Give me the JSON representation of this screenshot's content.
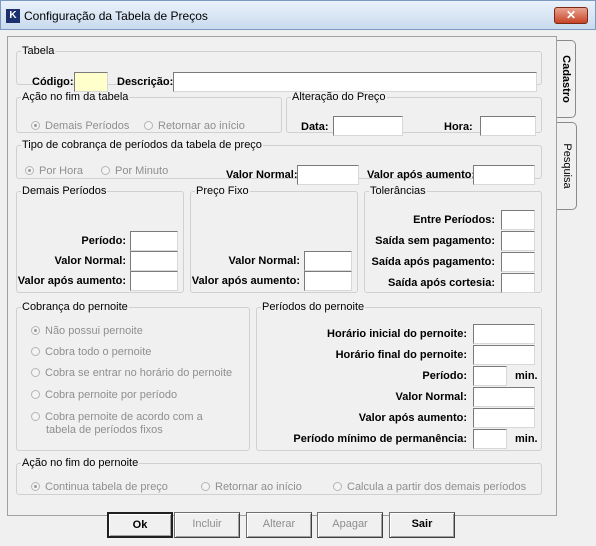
{
  "window": {
    "title": "Configuração da Tabela de Preços",
    "close_label": "✕",
    "icon_text": "K"
  },
  "tabs": [
    {
      "label": "Cadastro"
    },
    {
      "label": "Pesquisa"
    }
  ],
  "tabela": {
    "legend": "Tabela",
    "codigo_label": "Código:",
    "codigo_value": "",
    "descricao_label": "Descrição:",
    "descricao_value": ""
  },
  "acao_fim_tabela": {
    "legend": "Ação no fim da tabela",
    "options": [
      {
        "label": "Demais Períodos",
        "selected": true
      },
      {
        "label": "Retornar ao início",
        "selected": false
      }
    ]
  },
  "alteracao_preco": {
    "legend": "Alteração do Preço",
    "data_label": "Data:",
    "data_value": "",
    "hora_label": "Hora:",
    "hora_value": ""
  },
  "tipo_cobranca": {
    "legend": "Tipo de cobrança de períodos da tabela de preço",
    "options": [
      {
        "label": "Por Hora",
        "selected": true
      },
      {
        "label": "Por Minuto",
        "selected": false
      }
    ],
    "valor_normal_label": "Valor Normal:",
    "valor_normal_value": "",
    "valor_apos_label": "Valor após aumento:",
    "valor_apos_value": ""
  },
  "demais_periodos": {
    "legend": "Demais Períodos",
    "periodo_label": "Período:",
    "valor_normal_label": "Valor Normal:",
    "valor_apos_label": "Valor após aumento:"
  },
  "preco_fixo": {
    "legend": "Preço Fixo",
    "valor_normal_label": "Valor Normal:",
    "valor_apos_label": "Valor após aumento:"
  },
  "tolerancias": {
    "legend": "Tolerâncias",
    "entre_label": "Entre Períodos:",
    "saida_sem_label": "Saída sem pagamento:",
    "saida_apos_pag_label": "Saída após pagamento:",
    "saida_apos_cort_label": "Saída após cortesia:"
  },
  "cobranca_pernoite": {
    "legend": "Cobrança do pernoite",
    "options": [
      {
        "label": "Não possui pernoite",
        "selected": true
      },
      {
        "label": "Cobra todo o pernoite",
        "selected": false
      },
      {
        "label": "Cobra se entrar no horário do pernoite",
        "selected": false
      },
      {
        "label": "Cobra pernoite por período",
        "selected": false
      },
      {
        "label": "Cobra pernoite de acordo com a",
        "label2": "tabela de períodos fixos",
        "selected": false
      }
    ]
  },
  "periodos_pernoite": {
    "legend": "Períodos do pernoite",
    "horario_inicial_label": "Horário inicial do pernoite:",
    "horario_final_label": "Horário final do pernoite:",
    "periodo_label": "Período:",
    "periodo_unit": "min.",
    "valor_normal_label": "Valor Normal:",
    "valor_apos_label": "Valor após aumento:",
    "permanencia_label": "Período mínimo de permanência:",
    "permanencia_unit": "min."
  },
  "acao_fim_pernoite": {
    "legend": "Ação no fim do pernoite",
    "options": [
      {
        "label": "Continua tabela de preço",
        "selected": true
      },
      {
        "label": "Retornar ao início",
        "selected": false
      },
      {
        "label": "Calcula a partir dos demais períodos",
        "selected": false
      }
    ]
  },
  "buttons": {
    "ok": "Ok",
    "incluir": "Incluir",
    "alterar": "Alterar",
    "apagar": "Apagar",
    "sair": "Sair"
  }
}
